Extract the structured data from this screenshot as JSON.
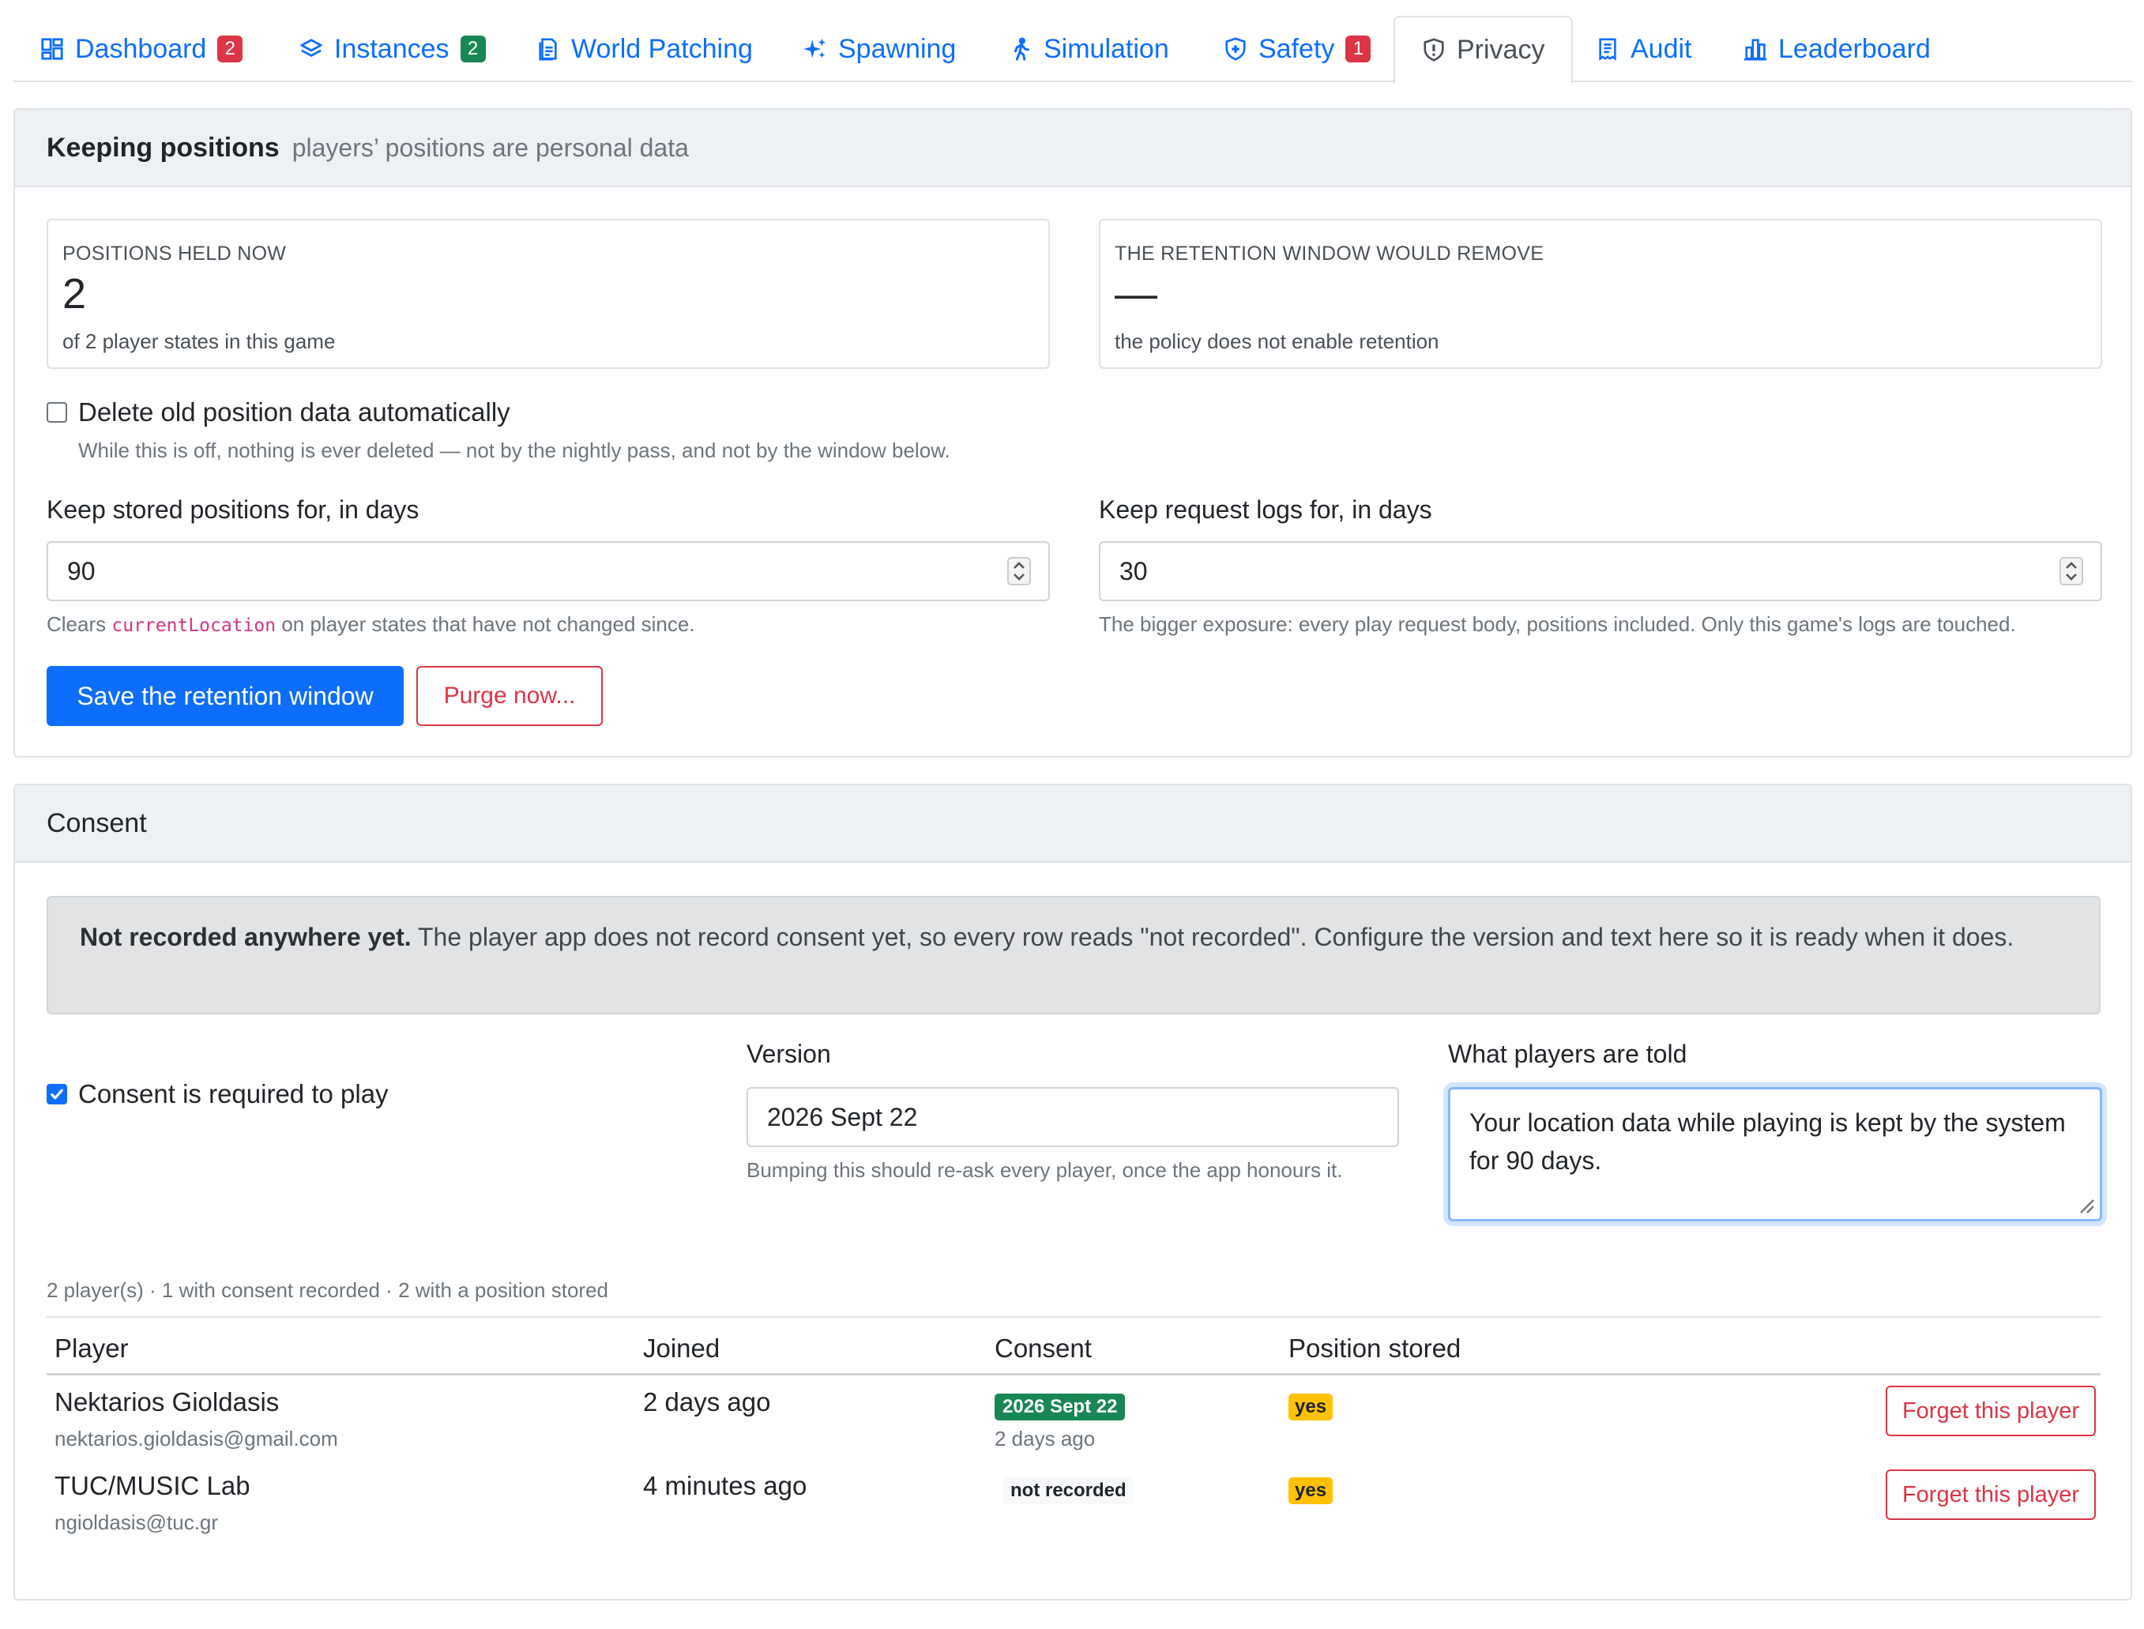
{
  "tabs": [
    {
      "label": "Dashboard",
      "icon": "dashboard-icon",
      "badge": "2",
      "badge_color": "#dc3545"
    },
    {
      "label": "Instances",
      "icon": "layers-icon",
      "badge": "2",
      "badge_color": "#198754"
    },
    {
      "label": "World Patching",
      "icon": "file-icon"
    },
    {
      "label": "Spawning",
      "icon": "sparkles-icon"
    },
    {
      "label": "Simulation",
      "icon": "walking-person-icon"
    },
    {
      "label": "Safety",
      "icon": "shield-plus-icon",
      "badge": "1",
      "badge_color": "#dc3545"
    },
    {
      "label": "Privacy",
      "icon": "shield-exclamation-icon",
      "active": true
    },
    {
      "label": "Audit",
      "icon": "receipt-icon"
    },
    {
      "label": "Leaderboard",
      "icon": "bar-chart-icon"
    }
  ],
  "retention": {
    "title": "Keeping positions",
    "subtitle": "players’ positions are personal data",
    "stat_held": {
      "label": "POSITIONS HELD NOW",
      "value": "2",
      "sub": "of 2 player states in this game"
    },
    "stat_remove": {
      "label": "THE RETENTION WINDOW WOULD REMOVE",
      "value": "—",
      "sub": "the policy does not enable retention"
    },
    "auto_delete": {
      "label": "Delete old position data automatically",
      "checked": false,
      "help": "While this is off, nothing is ever deleted — not by the nightly pass, and not by the window below."
    },
    "positions_days": {
      "label": "Keep stored positions for, in days",
      "value": "90",
      "help_prefix": "Clears",
      "help_code": "currentLocation",
      "help_suffix": "on player states that have not changed since."
    },
    "logs_days": {
      "label": "Keep request logs for, in days",
      "value": "30",
      "help": "The bigger exposure: every play request body, positions included. Only this game's logs are touched."
    },
    "save_button": "Save the retention window",
    "purge_button": "Purge now..."
  },
  "consent": {
    "title": "Consent",
    "alert_bold": "Not recorded anywhere yet.",
    "alert_text": " The player app does not record consent yet, so every row reads \"not recorded\". Configure the version and text here so it is ready when it does.",
    "required": {
      "label": "Consent is required to play",
      "checked": true
    },
    "version": {
      "label": "Version",
      "value": "2026 Sept 22",
      "help": "Bumping this should re-ask every player, once the app honours it."
    },
    "told": {
      "label": "What players are told",
      "value": "Your location data while playing is kept by the system for 90 days."
    },
    "summary": "2 player(s) · 1 with consent recorded · 2 with a position stored",
    "columns": [
      "Player",
      "Joined",
      "Consent",
      "Position stored"
    ],
    "rows": [
      {
        "name": "Nektarios Gioldasis",
        "email": "nektarios.gioldasis@gmail.com",
        "joined": "2 days ago",
        "consent": "2026 Sept 22",
        "consent_when": "2 days ago",
        "position": "yes",
        "action": "Forget this player"
      },
      {
        "name": "TUC/MUSIC Lab",
        "email": "ngioldasis@tuc.gr",
        "joined": "4 minutes ago",
        "consent": "not recorded",
        "consent_when": "",
        "position": "yes",
        "action": "Forget this player"
      }
    ]
  }
}
